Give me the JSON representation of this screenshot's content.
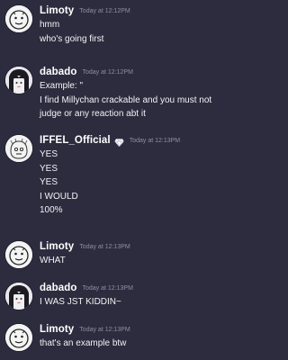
{
  "messages": [
    {
      "username": "Limoty",
      "timestamp": "Today at 12:12PM",
      "lines": [
        "hmm",
        "who's going first"
      ]
    },
    {
      "username": "dabado",
      "timestamp": "Today at 12:12PM",
      "lines": [
        "Example: \"",
        "I find Millychan crackable and you must not",
        "judge or any reaction abt it"
      ]
    },
    {
      "username": "IFFEL_Official",
      "timestamp": "Today at 12:13PM",
      "badge_icon": "gem-badge-icon",
      "lines": [
        "YES",
        "YES",
        "YES",
        "I WOULD",
        "100%"
      ]
    },
    {
      "username": "Limoty",
      "timestamp": "Today at 12:13PM",
      "lines": [
        "WHAT"
      ]
    },
    {
      "username": "dabado",
      "timestamp": "Today at 12:13PM",
      "lines": [
        "I WAS JST KIDDIN~"
      ]
    },
    {
      "username": "Limoty",
      "timestamp": "Today at 12:13PM",
      "lines": [
        "that's an example btw"
      ]
    }
  ],
  "colors": {
    "background": "#2d2c3f",
    "username": "#ffffff",
    "timestamp": "#8f8e9e",
    "message_text": "#f2f2f4"
  }
}
